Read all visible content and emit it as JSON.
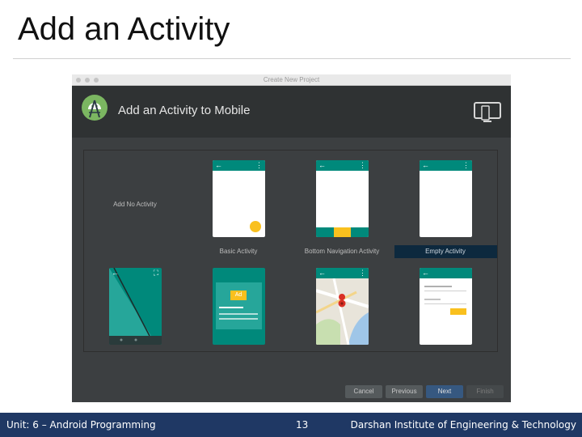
{
  "slide": {
    "title": "Add an Activity"
  },
  "window": {
    "title": "Create New Project"
  },
  "dialog": {
    "heading": "Add an Activity to Mobile",
    "tiles": [
      {
        "label": "Add No Activity"
      },
      {
        "label": "Basic Activity"
      },
      {
        "label": "Bottom Navigation Activity"
      },
      {
        "label": "Empty Activity",
        "selected": true
      },
      {
        "label": ""
      },
      {
        "label": ""
      },
      {
        "label": ""
      },
      {
        "label": ""
      }
    ],
    "ad_badge": "Ad",
    "buttons": {
      "cancel": "Cancel",
      "previous": "Previous",
      "next": "Next",
      "finish": "Finish"
    }
  },
  "footer": {
    "left": "Unit: 6 – Android Programming",
    "page": "13",
    "right": "Darshan Institute of Engineering & Technology"
  },
  "colors": {
    "teal": "#00897b",
    "amber": "#f9c01e",
    "footer_bg": "#1f3864",
    "selection": "#0d293e"
  }
}
